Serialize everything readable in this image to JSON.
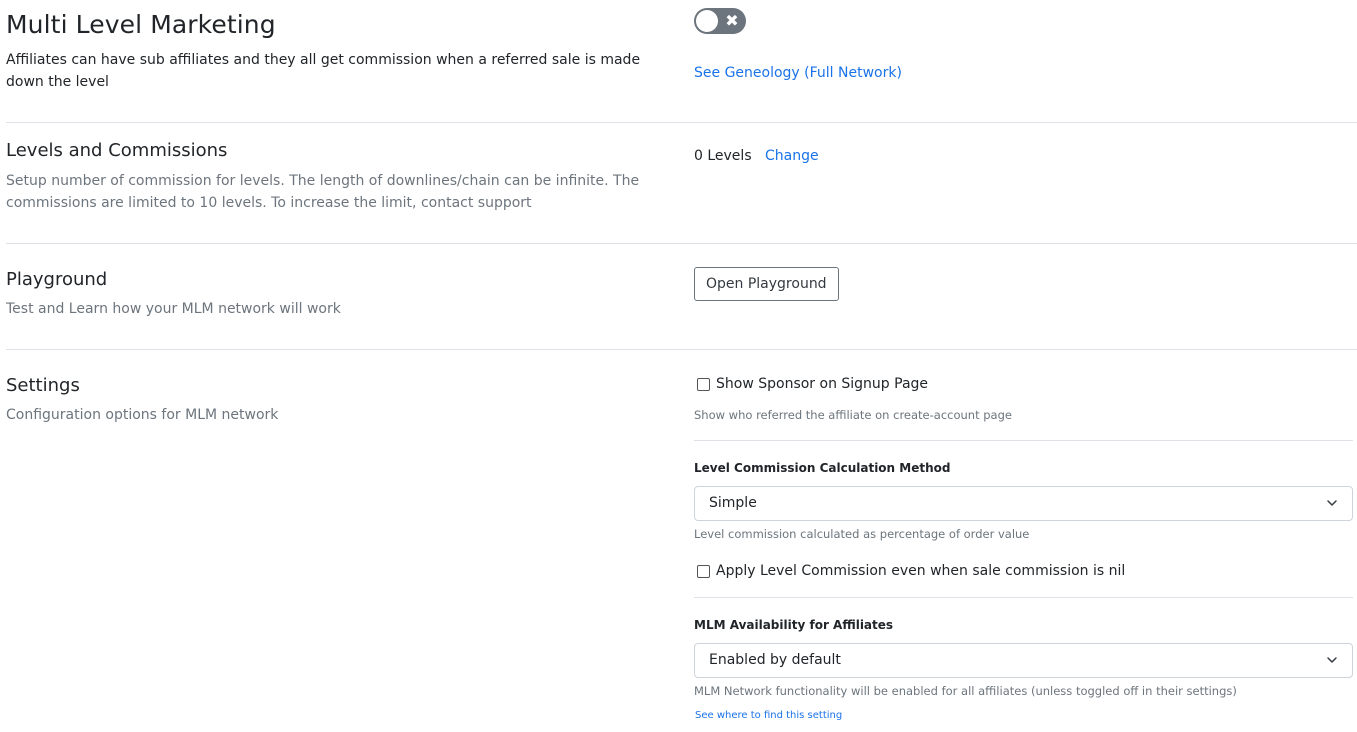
{
  "mlm": {
    "title": "Multi Level Marketing",
    "description": "Affiliates can have sub affiliates and they all get commission when a referred sale is made down the level",
    "toggle_enabled": false,
    "geneology_link": "See Geneology (Full Network)"
  },
  "levels": {
    "title": "Levels and Commissions",
    "description": "Setup number of commission for levels. The length of downlines/chain can be infinite. The commissions are limited to 10 levels. To increase the limit, contact support",
    "count_label": "0 Levels",
    "change_link": "Change"
  },
  "playground": {
    "title": "Playground",
    "description": "Test and Learn how your MLM network will work",
    "button_label": "Open Playground"
  },
  "settings": {
    "title": "Settings",
    "description": "Configuration options for MLM network",
    "show_sponsor": {
      "label": "Show Sponsor on Signup Page",
      "checked": false,
      "help": "Show who referred the affiliate on create-account page"
    },
    "calc_method": {
      "label": "Level Commission Calculation Method",
      "value": "Simple",
      "help": "Level commission calculated as percentage of order value"
    },
    "apply_nil": {
      "label": "Apply Level Commission even when sale commission is nil",
      "checked": false
    },
    "availability": {
      "label": "MLM Availability for Affiliates",
      "value": "Enabled by default",
      "help": "MLM Network functionality will be enabled for all affiliates (unless toggled off in their settings)",
      "link": "See where to find this setting"
    }
  },
  "colors": {
    "link": "#1a73e8",
    "muted": "#6c757d",
    "toggle_off": "#6c757d",
    "divider": "#dee2e6"
  }
}
